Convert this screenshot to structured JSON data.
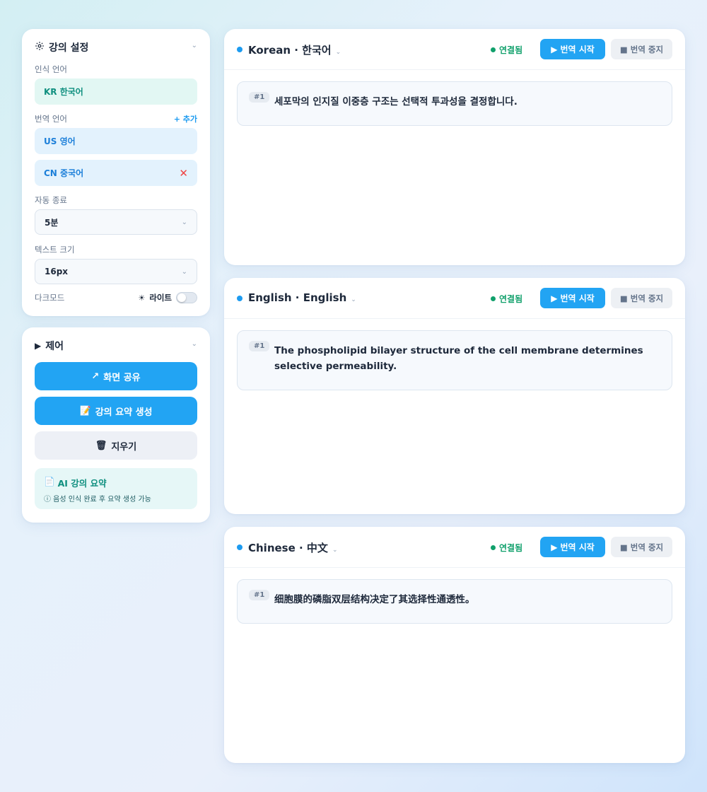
{
  "settings": {
    "title": "강의 설정",
    "icon": "gear-icon",
    "recognition_language_label": "인식 언어",
    "recognition_language_value": "KR 한국어",
    "translation_language_label": "번역 언어",
    "add_label": "+ 추가",
    "translation_languages": [
      "US 영어",
      "CN 중국어"
    ],
    "auto_end_label": "자동 종료",
    "auto_end_value": "5분",
    "text_size_label": "텍스트 크기",
    "text_size_value": "16px",
    "dark_mode_label": "다크모드",
    "theme_value": "라이트",
    "dark_mode_on": false
  },
  "control": {
    "title": "제어",
    "share_screen_label": "화면 공유",
    "generate_summary_label": "강의 요약 생성",
    "clear_label": "지우기",
    "summary_title": "AI 강의 요약",
    "summary_note": "ⓘ 음성 인식 완료 후 요약 생성 가능"
  },
  "panels": [
    {
      "title": "Korean · 한국어",
      "status": "연결됨",
      "start_label": "번역 시작",
      "stop_label": "번역 중지",
      "segment_number": "#1",
      "segment_text": "세포막의 인지질 이중층 구조는 선택적 투과성을 결정합니다."
    },
    {
      "title": "English · English",
      "status": "연결됨",
      "start_label": "번역 시작",
      "stop_label": "번역 중지",
      "segment_number": "#1",
      "segment_text": "The phospholipid bilayer structure of the cell membrane determines selective permeability."
    },
    {
      "title": "Chinese · 中文",
      "status": "연결됨",
      "start_label": "번역 시작",
      "stop_label": "번역 중지",
      "segment_number": "#1",
      "segment_text": "细胞膜的磷脂双层结构决定了其选择性通透性。"
    }
  ],
  "colors": {
    "accent": "#22a4f3",
    "connected": "#10a06b",
    "remove": "#ef4444",
    "teal": "#0f8f7f"
  }
}
